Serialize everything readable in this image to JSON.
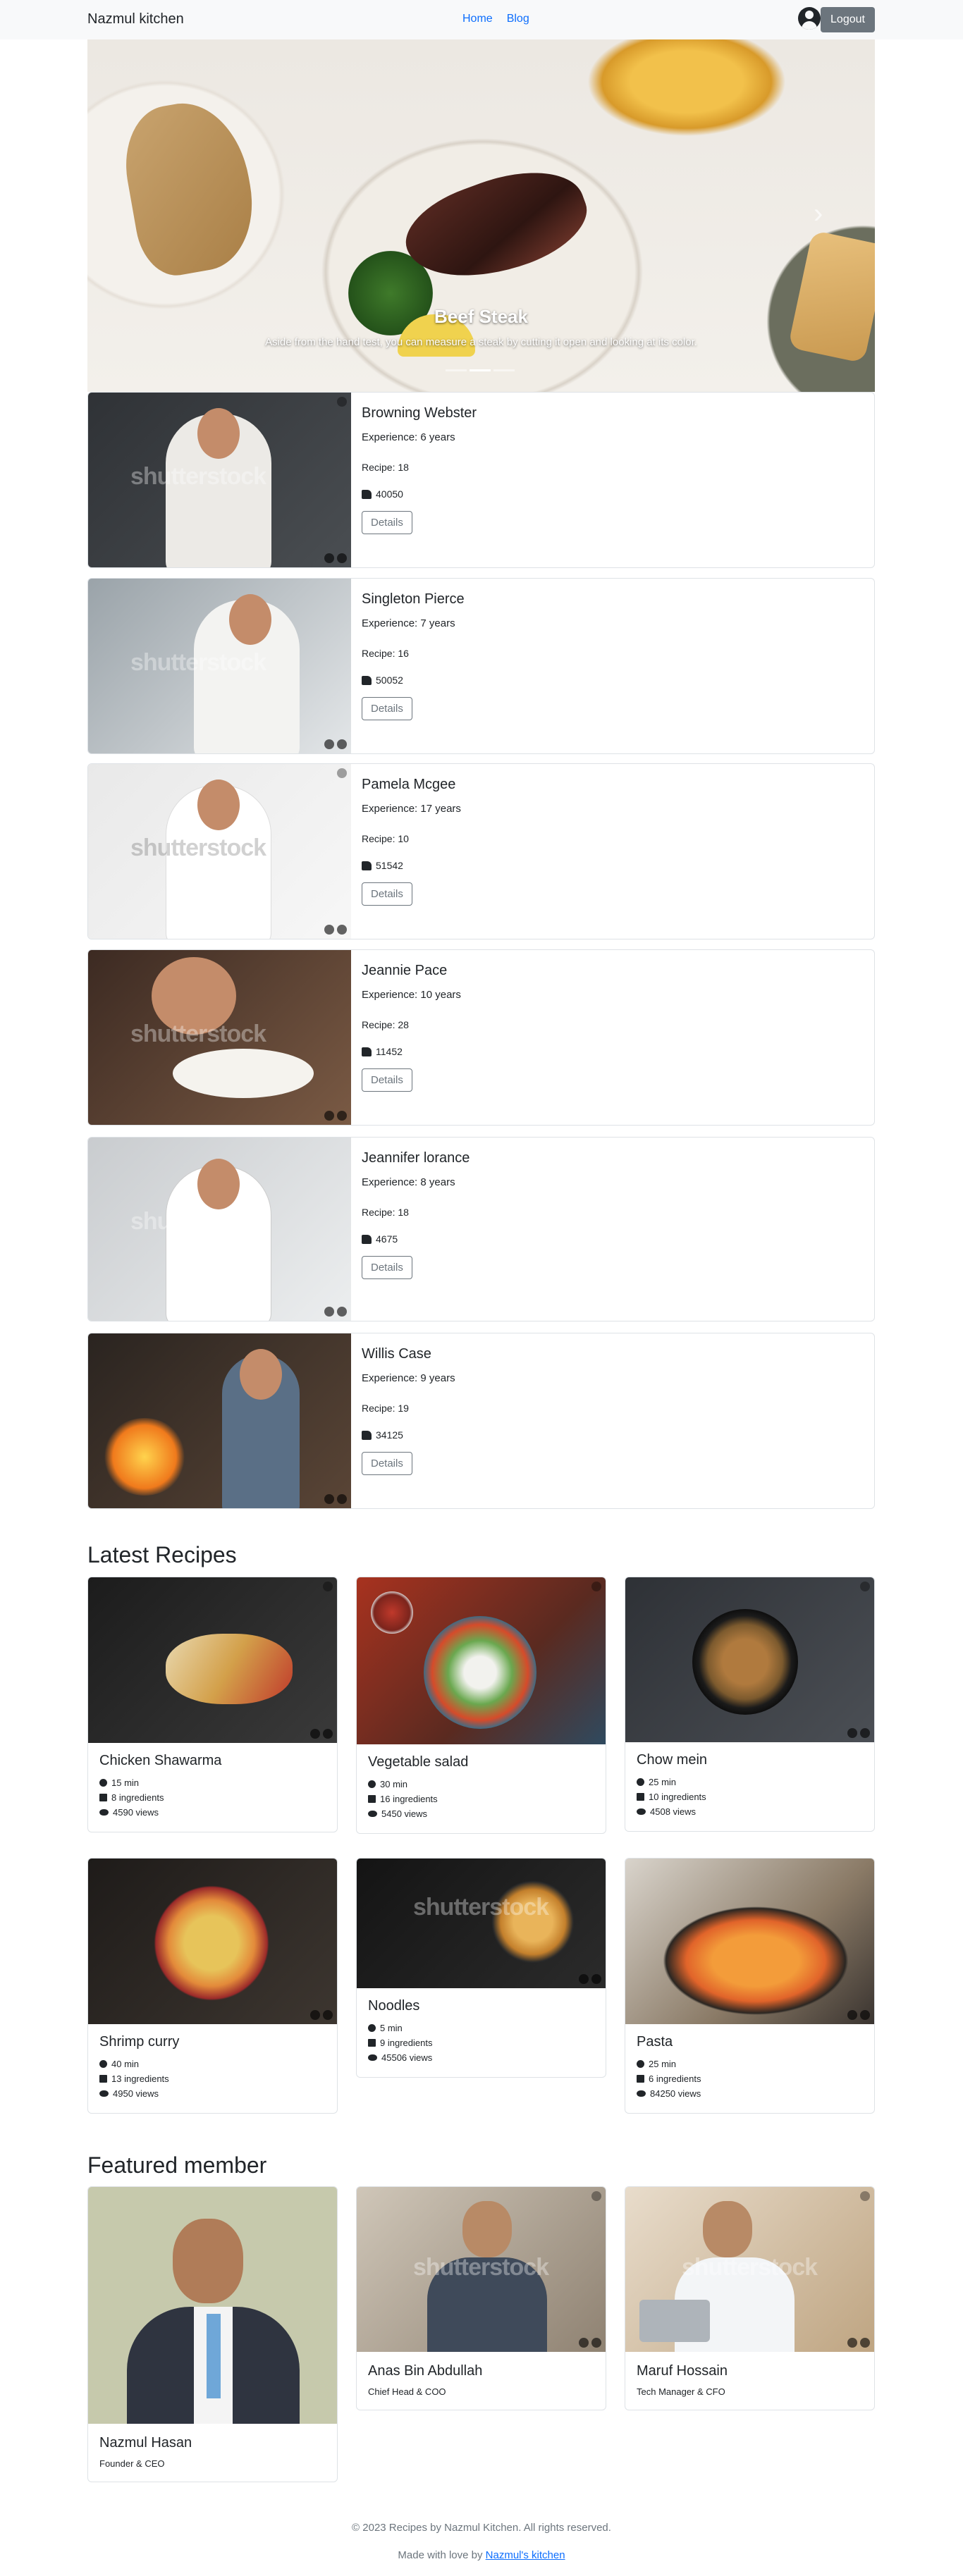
{
  "navbar": {
    "brand": "Nazmul kitchen",
    "links": [
      "Home",
      "Blog"
    ],
    "logout_label": "Logout"
  },
  "carousel": {
    "title": "Beef Steak",
    "caption": "Aside from the hand test, you can measure a steak by cutting it open and looking at its color."
  },
  "chefs": [
    {
      "name": "Browning Webster",
      "experience": "Experience: 6 years",
      "recipes": "Recipe: 18",
      "likes": "40050",
      "button": "Details"
    },
    {
      "name": "Singleton Pierce",
      "experience": "Experience: 7 years",
      "recipes": "Recipe: 16",
      "likes": "50052",
      "button": "Details"
    },
    {
      "name": "Pamela Mcgee",
      "experience": "Experience: 17 years",
      "recipes": "Recipe: 10",
      "likes": "51542",
      "button": "Details"
    },
    {
      "name": "Jeannie Pace",
      "experience": "Experience: 10 years",
      "recipes": "Recipe: 28",
      "likes": "11452",
      "button": "Details"
    },
    {
      "name": "Jeannifer lorance",
      "experience": "Experience: 8 years",
      "recipes": "Recipe: 18",
      "likes": "4675",
      "button": "Details"
    },
    {
      "name": "Willis Case",
      "experience": "Experience: 9 years",
      "recipes": "Recipe: 19",
      "likes": "34125",
      "button": "Details"
    }
  ],
  "watermark": "shutterstock",
  "latest_recipes": {
    "title": "Latest Recipes",
    "items": [
      {
        "name": "Chicken Shawarma",
        "time": "15 min",
        "ingredients": "8 ingredients",
        "views": "4590 views"
      },
      {
        "name": "Vegetable salad",
        "time": "30 min",
        "ingredients": "16 ingredients",
        "views": "5450 views"
      },
      {
        "name": "Chow mein",
        "time": "25 min",
        "ingredients": "10 ingredients",
        "views": "4508 views"
      },
      {
        "name": "Shrimp curry",
        "time": "40 min",
        "ingredients": "13 ingredients",
        "views": "4950 views"
      },
      {
        "name": "Noodles",
        "time": "5 min",
        "ingredients": "9 ingredients",
        "views": "45506 views"
      },
      {
        "name": "Pasta",
        "time": "25 min",
        "ingredients": "6 ingredients",
        "views": "84250 views"
      }
    ]
  },
  "featured": {
    "title": "Featured member",
    "members": [
      {
        "name": "Nazmul Hasan",
        "role": "Founder & CEO"
      },
      {
        "name": "Anas Bin Abdullah",
        "role": "Chief Head & COO"
      },
      {
        "name": "Maruf Hossain",
        "role": "Tech Manager & CFO"
      }
    ]
  },
  "footer": {
    "copyright": "© 2023 Recipes by Nazmul Kitchen. All rights reserved.",
    "made_with": "Made with love by",
    "link": "Nazmul's kitchen"
  }
}
